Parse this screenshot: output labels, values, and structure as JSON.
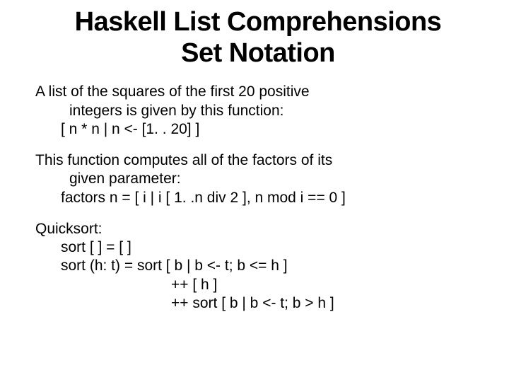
{
  "title": {
    "line1": "Haskell List Comprehensions",
    "line2": "Set Notation"
  },
  "sections": [
    {
      "intro": "A list of the squares of the first 20 positive",
      "intro2": "integers is given by this function:",
      "code1": "[ n * n | n <- [1. . 20] ]"
    },
    {
      "intro": "This function computes all of the factors of its",
      "intro2": "given parameter:",
      "code1": "factors n = [ i | i [ 1. .n div 2 ], n mod i == 0 ]"
    },
    {
      "intro": "Quicksort:",
      "code1": "sort [ ] = [ ]",
      "code2": "sort (h: t) = sort [ b | b <- t; b <= h ]",
      "code3": "++ [ h ]",
      "code4": "++ sort [ b | b <- t; b > h ]"
    }
  ]
}
